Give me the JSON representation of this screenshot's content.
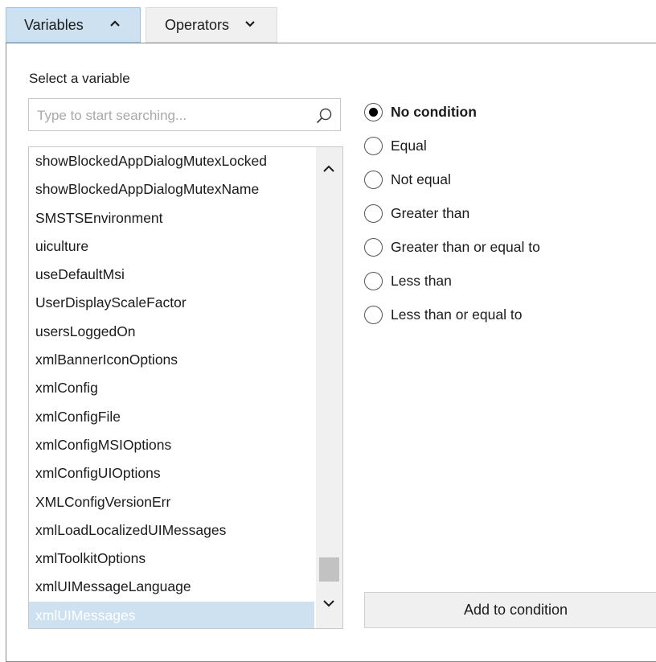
{
  "tabs": {
    "variables_label": "Variables",
    "operators_label": "Operators"
  },
  "select_label": "Select a variable",
  "search": {
    "placeholder": "Type to start searching..."
  },
  "variables": [
    "showBlockedAppDialogMutexLocked",
    "showBlockedAppDialogMutexName",
    "SMSTSEnvironment",
    "uiculture",
    "useDefaultMsi",
    "UserDisplayScaleFactor",
    "usersLoggedOn",
    "xmlBannerIconOptions",
    "xmlConfig",
    "xmlConfigFile",
    "xmlConfigMSIOptions",
    "xmlConfigUIOptions",
    "XMLConfigVersionErr",
    "xmlLoadLocalizedUIMessages",
    "xmlToolkitOptions",
    "xmlUIMessageLanguage",
    "xmlUIMessages"
  ],
  "selected_variable": "xmlUIMessages",
  "operators": [
    {
      "label": "No condition",
      "checked": true
    },
    {
      "label": "Equal",
      "checked": false
    },
    {
      "label": "Not equal",
      "checked": false
    },
    {
      "label": "Greater than",
      "checked": false
    },
    {
      "label": "Greater than or equal to",
      "checked": false
    },
    {
      "label": "Less than",
      "checked": false
    },
    {
      "label": "Less than or equal to",
      "checked": false
    }
  ],
  "add_button_label": "Add to condition",
  "colors": {
    "active_tab": "#cde1f1",
    "selection": "#cde1f1",
    "button_bg": "#f0f0f0"
  }
}
